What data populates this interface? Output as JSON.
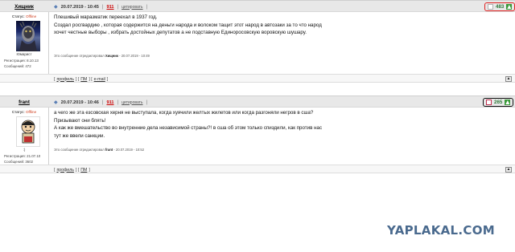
{
  "posts": [
    {
      "author": "Хищник",
      "status_label": "Статус:",
      "status_value": "Offline",
      "rank": "Юмарист",
      "reg_label": "Регистрация:",
      "reg_date": "8.10.13",
      "msgs_label": "Сообщений:",
      "msgs_count": "472",
      "date": "20.07.2019 - 10:45",
      "post_number": "911",
      "quote_label": "цитировать",
      "score": "483",
      "body_lines": [
        "Плешивый маразматик переехал в 1937 год.",
        "Создал росгвардию , которая содержится на деньги народа и волоком тащит этот народ в автозаки за то что народ",
        "хочет честные выборы , избрать достойных депутатов а не подставную Единоросовскую воровскую шушару."
      ],
      "edit_prefix": "Это сообщение отредактировал",
      "edit_author": "Хищник",
      "edit_time": "- 20.07.2019 - 10:49",
      "footer_links": [
        "профиль",
        "ПМ",
        "e-mail"
      ]
    },
    {
      "author": "frant",
      "status_label": "Статус:",
      "status_value": "Offline",
      "rank": ":)",
      "reg_label": "Регистрация:",
      "reg_date": "21.07.10",
      "msgs_label": "Сообщений:",
      "msgs_count": "3602",
      "date": "20.07.2019 - 10:46",
      "post_number": "911",
      "quote_label": "цитировать",
      "score": "265",
      "body_lines": [
        "а чего же эта езсовская херня не выступала, когда хуячили желтых жилетов или когда разгоняли негров в сша?",
        "Призывают они блять!",
        "А как же вмешательство во внутренние дела независимой страны?! в сша об этом только спиздили, как против нас",
        "тут же ввели санкции."
      ],
      "edit_prefix": "Это сообщение отредактировал",
      "edit_author": "frant",
      "edit_time": "- 20.07.2019 - 10:52",
      "footer_links": [
        "профиль",
        "ПМ"
      ]
    }
  ],
  "watermark": "YAPLAKAL.COM",
  "colors": {
    "header_bg": "#e8e8e8",
    "offline": "#d04020",
    "post_number": "#cc0000",
    "score": "#2e7a3a",
    "rating_highlight_1": "#e02020",
    "rating_highlight_2": "#111111",
    "watermark": "#4a6a8e"
  },
  "icons": {
    "post_icon": "diamond-post-icon",
    "vote_down": "vote-down-icon",
    "vote_up": "vote-up-icon",
    "scroll_top": "scroll-top-icon"
  }
}
